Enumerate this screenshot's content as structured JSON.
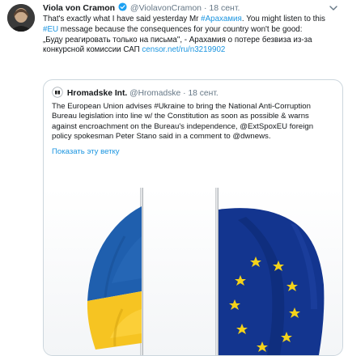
{
  "tweet": {
    "author_name": "Viola von Cramon",
    "author_handle": "@ViolavonCramon",
    "separator": "·",
    "date": "18 сент.",
    "body": {
      "p1_a": "That's exactly what I have said yesterday Mr ",
      "p1_hashtag": "#Арахамия",
      "p1_b": ". You might listen to this ",
      "p1_hashtag2": "#EU",
      "p1_c": " message because the consequences for your country won't be good:",
      "p2_a": "„Буду реагировать только на письма\", - Арахамия о потере безвиза из-за конкурсной комиссии САП ",
      "p2_link": "censor.net/ru/n3219902"
    }
  },
  "quoted": {
    "author_name": "Hromadske Int.",
    "author_handle": "@Hromadske",
    "separator": "·",
    "date": "18 сент.",
    "text": "The European Union advises #Ukraine to bring the National Anti-Corruption Bureau legislation into line w/ the Constitution as soon as possible & warns against encroachment on the Bureau's independence, @ExtSpoxEU foreign policy spokesman Peter Stano said in a comment to @dwnews.",
    "show_thread": "Показать эту ветку"
  },
  "colors": {
    "link": "#1b95e0",
    "muted": "#657786",
    "verified": "#1da1f2",
    "ukraine_blue": "#1f5fae",
    "ukraine_yellow": "#f6c422",
    "eu_blue": "#13358f",
    "eu_star": "#f4d21a"
  },
  "icons": {
    "verified": "verified-badge-icon",
    "more": "chevron-down-icon"
  }
}
